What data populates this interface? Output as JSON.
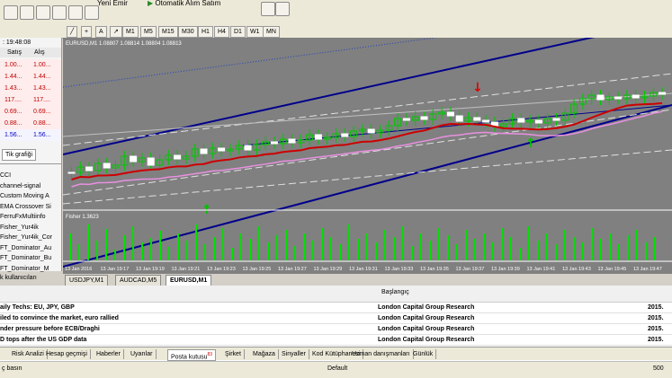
{
  "toolbar": {
    "new_order_label": "Yeni Emir",
    "expert_label": "Otomatik Alım Satım"
  },
  "timeframes": [
    "M1",
    "M5",
    "M15",
    "M30",
    "H1",
    "H4",
    "D1",
    "W1",
    "MN"
  ],
  "market_watch": {
    "time": "19:48:08",
    "bid_header": "Satış",
    "ask_header": "Alış",
    "rows": [
      {
        "bid": "1.00...",
        "ask": "1.00..."
      },
      {
        "bid": "1.44...",
        "ask": "1.44..."
      },
      {
        "bid": "1.43...",
        "ask": "1.43..."
      },
      {
        "bid": "117....",
        "ask": "117...."
      },
      {
        "bid": "0.69...",
        "ask": "0.69..."
      },
      {
        "bid": "0.88...",
        "ask": "0.88..."
      },
      {
        "bid": "1.56...",
        "ask": "1.56..."
      }
    ],
    "tick_chart_tab": "Tik grafiği"
  },
  "navigator": {
    "items": [
      "CCI",
      "channel-signal",
      "Custom Moving A",
      "EMA Crossover Si",
      "FerruFxMultiinfo",
      "Fisher_Yur4ik",
      "Fisher_Yur4ik_Cor",
      "FT_Dominator_Au",
      "FT_Dominator_Bu",
      "FT_Dominator_M"
    ],
    "footer": "k kullanıcıları"
  },
  "chart": {
    "title": "EURUSD,M1  1.08807 1.08814 1.08804 1.08813",
    "fisher_label": "Fisher 1.3623",
    "time_labels": [
      "13 Jan 2016",
      "13 Jan 19:17",
      "13 Jan 19:19",
      "13 Jan 19:21",
      "13 Jan 19:23",
      "13 Jan 19:25",
      "13 Jan 19:27",
      "13 Jan 19:29",
      "13 Jan 19:31",
      "13 Jan 19:33",
      "13 Jan 19:35",
      "13 Jan 19:37",
      "13 Jan 19:39",
      "13 Jan 19:41",
      "13 Jan 19:43",
      "13 Jan 19:45",
      "13 Jan 19:47"
    ]
  },
  "chart_tabs": [
    "USDJPY,M1",
    "AUDCAD,M5",
    "EURUSD,M1"
  ],
  "terminal": {
    "header": "Başlangıç",
    "news": [
      {
        "title": "aily Techs: EU, JPY, GBP",
        "source": "London Capital Group Research",
        "date": "2015."
      },
      {
        "title": "iled to convince the market, euro rallied",
        "source": "London Capital Group Research",
        "date": "2015."
      },
      {
        "title": "nder pressure before ECB/Draghi",
        "source": "London Capital Group Research",
        "date": "2015."
      },
      {
        "title": "D tops after the US GDP data",
        "source": "London Capital Group Research",
        "date": "2015."
      }
    ],
    "tabs": [
      "Risk Analizi",
      "Hesap geçmişi",
      "Haberler",
      "Uyarılar",
      "Posta kutusu",
      "Şirket",
      "Mağaza",
      "Sinyaller",
      "Kod Kütüphanesi",
      "Uzman danışmanları",
      "Günlük"
    ],
    "mailbox_badge": "83",
    "status_left": "ç basın",
    "status_mid": "Default",
    "status_right": "500"
  },
  "colors": {
    "chart_bg": "#808080",
    "candle": "#00c800",
    "ma_red": "#cc0000",
    "ma_pink": "#e890e0",
    "channel": "#00008b",
    "fisher": "#00e000"
  }
}
